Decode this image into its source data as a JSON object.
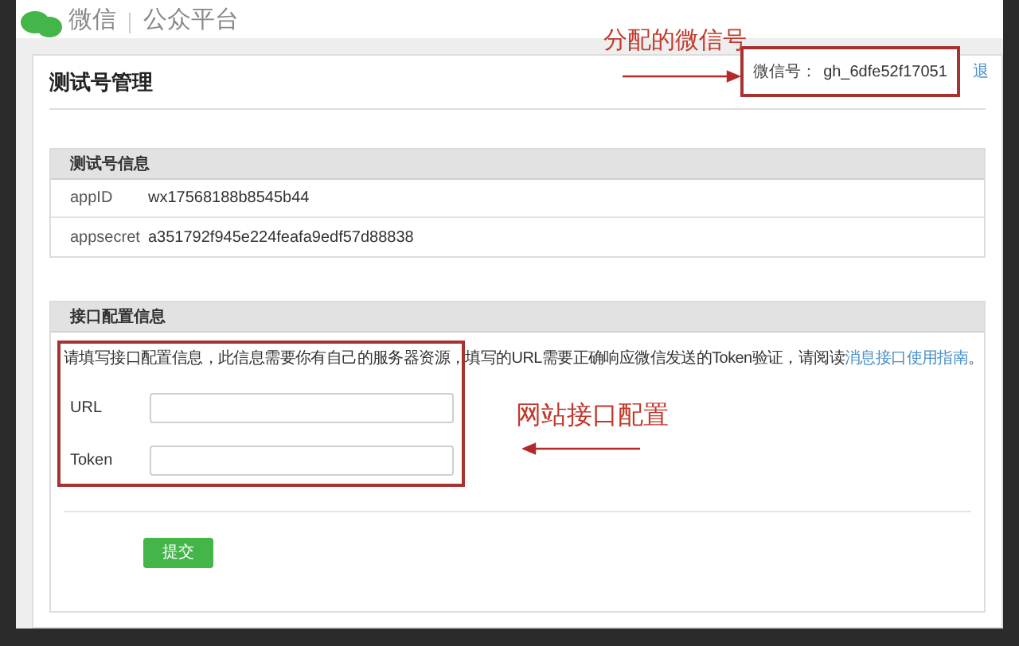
{
  "header": {
    "brand": "微信",
    "product": "公众平台"
  },
  "page": {
    "title": "测试号管理",
    "account_label": "微信号：",
    "account_id": "gh_6dfe52f17051",
    "logout": "退"
  },
  "sections": [
    {
      "kind": "info",
      "title": "测试号信息",
      "rows": [
        {
          "label": "appID",
          "value": "wx17568188b8545b44"
        },
        {
          "label": "appsecret",
          "value": "a351792f945e224feafa9edf57d88838"
        }
      ]
    },
    {
      "kind": "form",
      "title": "接口配置信息",
      "intro": "请填写接口配置信息，此信息需要你有自己的服务器资源，填写的URL需要正确响应微信发送的Token验证，请阅读",
      "link": "消息接口使用指南",
      "intro_end": "。",
      "fields": [
        {
          "label": "URL"
        },
        {
          "label": "Token"
        }
      ],
      "submit": "提交"
    }
  ],
  "annotations": [
    {
      "text": "分配的微信号"
    },
    {
      "text": "网站接口配置"
    }
  ]
}
